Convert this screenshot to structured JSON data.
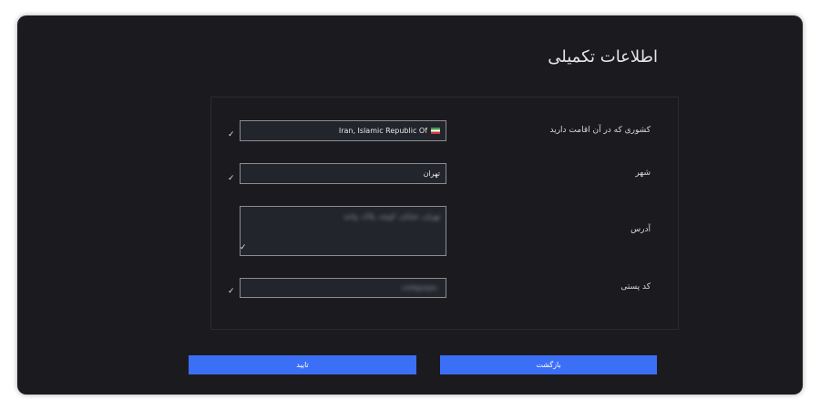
{
  "page": {
    "title": "اطلاعات تکمیلی"
  },
  "form": {
    "country": {
      "label": "کشوری که در آن اقامت دارید",
      "value": "Iran, Islamic Republic Of",
      "flag_icon": "iran-flag-icon"
    },
    "city": {
      "label": "شهر",
      "value": "تهران"
    },
    "address": {
      "label": "آدرس",
      "value": "تهران، خیابان، کوچه، پلاک، واحد"
    },
    "postal_code": {
      "label": "کد پستی",
      "value": "۱۲۳۴۵۶۷۸۹۰"
    },
    "valid_icon": "checkmark-icon",
    "check_glyph": "✓"
  },
  "buttons": {
    "confirm": "تایید",
    "back": "بازگشت"
  },
  "colors": {
    "background": "#1b1b1f",
    "accent": "#3b6ff5",
    "field": "#23252c"
  }
}
